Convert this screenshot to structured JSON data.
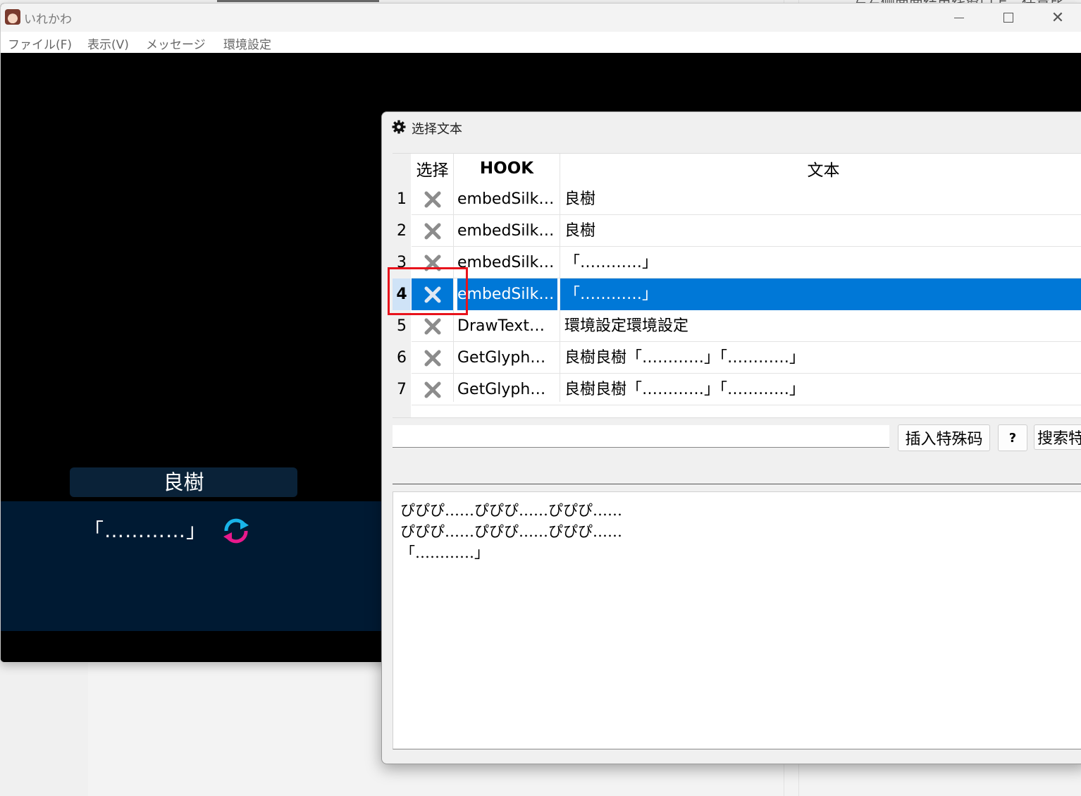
{
  "background": {
    "partial_text": "左右侧面面结束线窗口上、任意比"
  },
  "game_window": {
    "title": "いれかわ",
    "menu": [
      "ファイル(F)",
      "表示(V)",
      "メッセージ",
      "環境設定"
    ],
    "speaker_name": "良樹",
    "dialog_text": "「…………」",
    "cycle_icon": "refresh-cycle-icon"
  },
  "select_dialog": {
    "title": "选择文本",
    "title_icon": "gear-icon",
    "columns": {
      "select": "选择",
      "hook": "HOOK",
      "text": "文本"
    },
    "rows": [
      {
        "num": "1",
        "hook": "embedSilk…",
        "text": "良樹"
      },
      {
        "num": "2",
        "hook": "embedSilk…",
        "text": "良樹"
      },
      {
        "num": "3",
        "hook": "embedSilk…",
        "text": "「…………」"
      },
      {
        "num": "4",
        "hook": "embedSilk…",
        "text": "「…………」"
      },
      {
        "num": "5",
        "hook": "DrawText…",
        "text": "環境設定環境設定"
      },
      {
        "num": "6",
        "hook": "GetGlyph…",
        "text": "良樹良樹「…………」「…………」"
      },
      {
        "num": "7",
        "hook": "GetGlyph…",
        "text": "良樹良樹「…………」「…………」"
      }
    ],
    "selected_row": 4,
    "special_code_input": "",
    "buttons": {
      "insert": "插入特殊码",
      "help": "?",
      "search": "搜索特"
    },
    "hook_code_input": "",
    "preview_lines": [
      "ぴぴぴ……ぴぴぴ……ぴぴぴ……",
      "ぴぴぴ……ぴぴぴ……ぴぴぴ……",
      "「…………」"
    ]
  },
  "colors": {
    "selection": "#0078d7",
    "highlight_box": "#e8131c",
    "dialog_band": "#001a33"
  }
}
